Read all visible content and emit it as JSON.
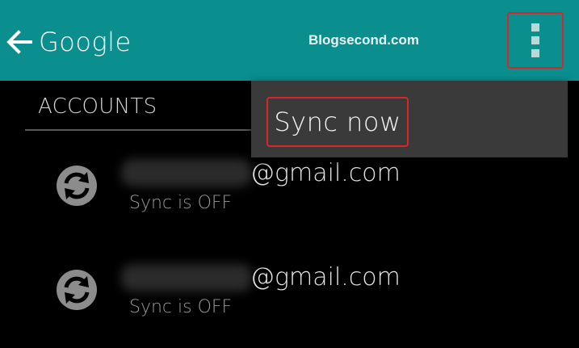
{
  "action_bar": {
    "title": "Google",
    "watermark": "Blogsecond.com",
    "background_color": "#0a8e8e",
    "back_icon": "arrow-left-icon",
    "overflow_icon": "more-vertical-icon"
  },
  "section": {
    "title": "ACCOUNTS"
  },
  "accounts": [
    {
      "domain": "@gmail.com",
      "status": "Sync is OFF",
      "icon": "sync-icon"
    },
    {
      "domain": "@gmail.com",
      "status": "Sync is OFF",
      "icon": "sync-icon"
    }
  ],
  "menu": {
    "items": [
      {
        "label": "Sync now"
      }
    ]
  },
  "highlight_color": "#d8272b"
}
